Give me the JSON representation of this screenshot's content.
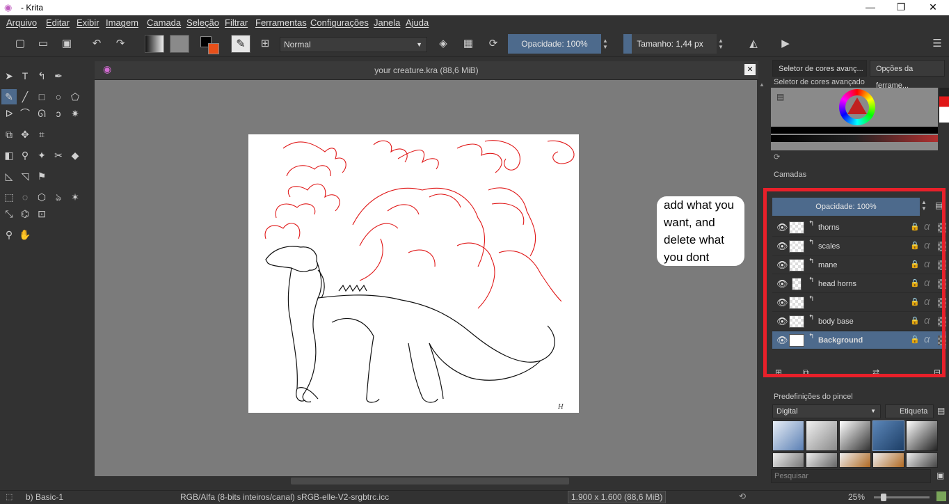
{
  "window": {
    "title": "- Krita",
    "minimize": "—",
    "restore": "❐",
    "close": "✕"
  },
  "menu": [
    "Arquivo",
    "Editar",
    "Exibir",
    "Imagem",
    "Camada",
    "Seleção",
    "Filtrar",
    "Ferramentas",
    "Configurações",
    "Janela",
    "Ajuda"
  ],
  "toolbar": {
    "blend_mode": "Normal",
    "opacity": "Opacidade: 100%",
    "size": "Tamanho: 1,44 px"
  },
  "document": {
    "tab_title": "your creature.kra (88,6 MiB)",
    "close": "✕"
  },
  "docker": {
    "tabs": [
      "Seletor de cores avanç...",
      "Opções da ferrame..."
    ],
    "color_selector_title": "Seletor de cores avançado",
    "layers_title": "Camadas",
    "layers_opacity": "Opacidade:  100%",
    "layers": [
      {
        "name": "thorns",
        "selected": false
      },
      {
        "name": "scales",
        "selected": false
      },
      {
        "name": "mane",
        "selected": false
      },
      {
        "name": "head horns",
        "selected": false
      },
      {
        "name": "",
        "selected": false
      },
      {
        "name": "body base",
        "selected": false
      },
      {
        "name": "Background",
        "selected": true
      }
    ],
    "brush_presets_title": "Predefinições do pincel",
    "brush_filter": "Digital",
    "brush_tag": "Etiqueta",
    "search_placeholder": "Pesquisar"
  },
  "annotation": {
    "bubble_text": "add what you want, and delete what you dont",
    "highlight_color": "#e8202a"
  },
  "status": {
    "brush": "b) Basic-1",
    "color_space": "RGB/Alfa (8-bits inteiros/canal)  sRGB-elle-V2-srgbtrc.icc",
    "dimensions": "1.900 x 1.600 (88,6 MiB)",
    "zoom": "25%"
  },
  "colors": {
    "accent": "#4d6a8c",
    "bg": "#323232",
    "canvas_bg": "#7b7b7b"
  }
}
